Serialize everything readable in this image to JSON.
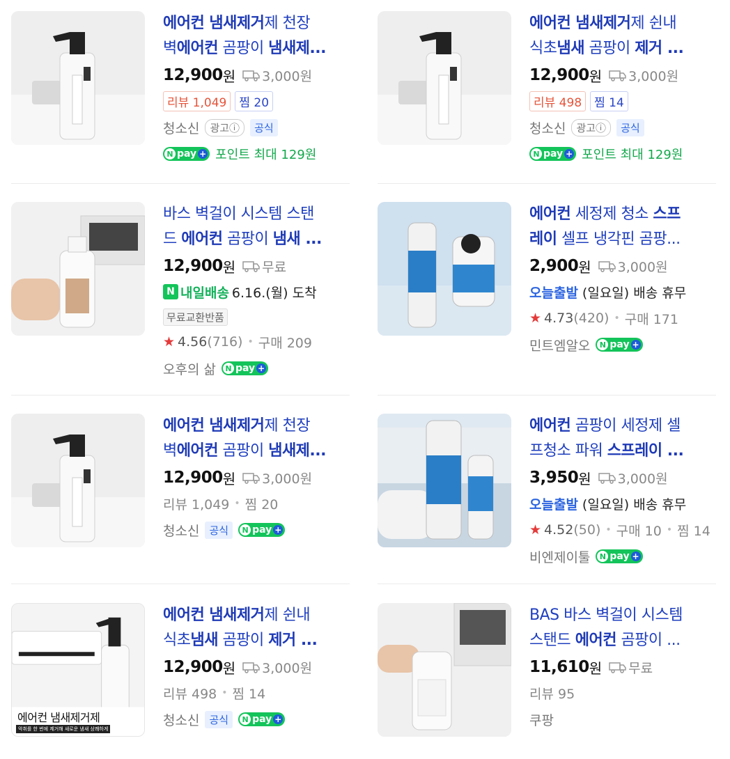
{
  "products": [
    {
      "title_line1": [
        {
          "t": "에어컨 냄새제거",
          "b": true
        },
        {
          "t": "제 천장",
          "b": false
        }
      ],
      "title_line2": [
        {
          "t": "벽",
          "b": false
        },
        {
          "t": "에어컨",
          "b": true
        },
        {
          "t": " 곰팡이 ",
          "b": false
        },
        {
          "t": "냄새제...",
          "b": true
        }
      ],
      "price": "12,900",
      "won": "원",
      "shipping": "3,000원",
      "review_tag": "리뷰 1,049",
      "zzim_tag": "찜 20",
      "seller": "청소신",
      "ad": "광고ⓘ",
      "official": "공식",
      "point_text": "포인트 최대 129원"
    },
    {
      "title_line1": [
        {
          "t": "에어컨 냄새제거",
          "b": true
        },
        {
          "t": "제 쉰내",
          "b": false
        }
      ],
      "title_line2": [
        {
          "t": "식초",
          "b": false
        },
        {
          "t": "냄새",
          "b": true
        },
        {
          "t": " 곰팡이 ",
          "b": false
        },
        {
          "t": "제거 ...",
          "b": true
        }
      ],
      "price": "12,900",
      "won": "원",
      "shipping": "3,000원",
      "review_tag": "리뷰 498",
      "zzim_tag": "찜 14",
      "seller": "청소신",
      "ad": "광고ⓘ",
      "official": "공식",
      "point_text": "포인트 최대 129원"
    },
    {
      "title_line1": [
        {
          "t": "바스 벽걸이 시스템 스탠",
          "b": false
        }
      ],
      "title_line2": [
        {
          "t": "드 ",
          "b": false
        },
        {
          "t": "에어컨",
          "b": true
        },
        {
          "t": " 곰팡이 ",
          "b": false
        },
        {
          "t": "냄새 ...",
          "b": true
        }
      ],
      "price": "12,900",
      "won": "원",
      "shipping": "무료",
      "tomorrow": "내일배송",
      "arrival": "6.16.(월) 도착",
      "free_exchange": "무료교환반품",
      "rating": "4.56",
      "rating_count": "(716)",
      "purchase": "구매 209",
      "seller": "오후의 삶"
    },
    {
      "title_line1": [
        {
          "t": "에어컨",
          "b": true
        },
        {
          "t": " 세정제 청소 ",
          "b": false
        },
        {
          "t": "스프",
          "b": true
        }
      ],
      "title_line2": [
        {
          "t": "레이",
          "b": true
        },
        {
          "t": " 셀프 냉각핀 곰팡...",
          "b": false
        }
      ],
      "price": "2,900",
      "won": "원",
      "shipping": "3,000원",
      "today": "오늘출발",
      "today_note": "(일요일) 배송 휴무",
      "rating": "4.73",
      "rating_count": "(420)",
      "purchase": "구매 171",
      "seller": "민트엠알오"
    },
    {
      "title_line1": [
        {
          "t": "에어컨 냄새제거",
          "b": true
        },
        {
          "t": "제 천장",
          "b": false
        }
      ],
      "title_line2": [
        {
          "t": "벽",
          "b": false
        },
        {
          "t": "에어컨",
          "b": true
        },
        {
          "t": " 곰팡이 ",
          "b": false
        },
        {
          "t": "냄새제...",
          "b": true
        }
      ],
      "price": "12,900",
      "won": "원",
      "shipping": "3,000원",
      "review": "리뷰 1,049",
      "zzim": "찜 20",
      "seller": "청소신",
      "official": "공식"
    },
    {
      "title_line1": [
        {
          "t": "에어컨",
          "b": true
        },
        {
          "t": " 곰팡이 세정제 셀",
          "b": false
        }
      ],
      "title_line2": [
        {
          "t": "프청소 파워 ",
          "b": false
        },
        {
          "t": "스프레이 ...",
          "b": true
        }
      ],
      "price": "3,950",
      "won": "원",
      "shipping": "3,000원",
      "today": "오늘출발",
      "today_note": "(일요일) 배송 휴무",
      "rating": "4.52",
      "rating_count": "(50)",
      "purchase": "구매 10",
      "zzim": "찜 14",
      "seller": "비엔제이툴"
    },
    {
      "title_line1": [
        {
          "t": "에어컨 냄새제거",
          "b": true
        },
        {
          "t": "제 쉰내",
          "b": false
        }
      ],
      "title_line2": [
        {
          "t": "식초",
          "b": false
        },
        {
          "t": "냄새",
          "b": true
        },
        {
          "t": " 곰팡이 ",
          "b": false
        },
        {
          "t": "제거 ...",
          "b": true
        }
      ],
      "price": "12,900",
      "won": "원",
      "shipping": "3,000원",
      "review": "리뷰 498",
      "zzim": "찜 14",
      "seller": "청소신",
      "official": "공식",
      "img_caption": "에어컨 냄새제거제",
      "img_subcaption": "악취를 한 번에 제거해 새로운 냄새 상쾌하게"
    },
    {
      "title_line1": [
        {
          "t": "BAS 바스 벽걸이 시스템",
          "b": false
        }
      ],
      "title_line2": [
        {
          "t": "스탠드 ",
          "b": false
        },
        {
          "t": "에어컨",
          "b": true
        },
        {
          "t": " 곰팡이 ...",
          "b": false
        }
      ],
      "price": "11,610",
      "won": "원",
      "shipping": "무료",
      "review": "리뷰 95",
      "seller": "쿠팡"
    }
  ],
  "npay": {
    "n": "N",
    "label": "pay",
    "plus": "+"
  },
  "colors": {
    "title": "#1f3fbf",
    "npay": "#13c45a",
    "star": "#e53a3a",
    "point": "#13a84c",
    "today": "#2b64e0"
  },
  "icons": {
    "shipping": "truck-icon",
    "rating": "star-icon"
  }
}
